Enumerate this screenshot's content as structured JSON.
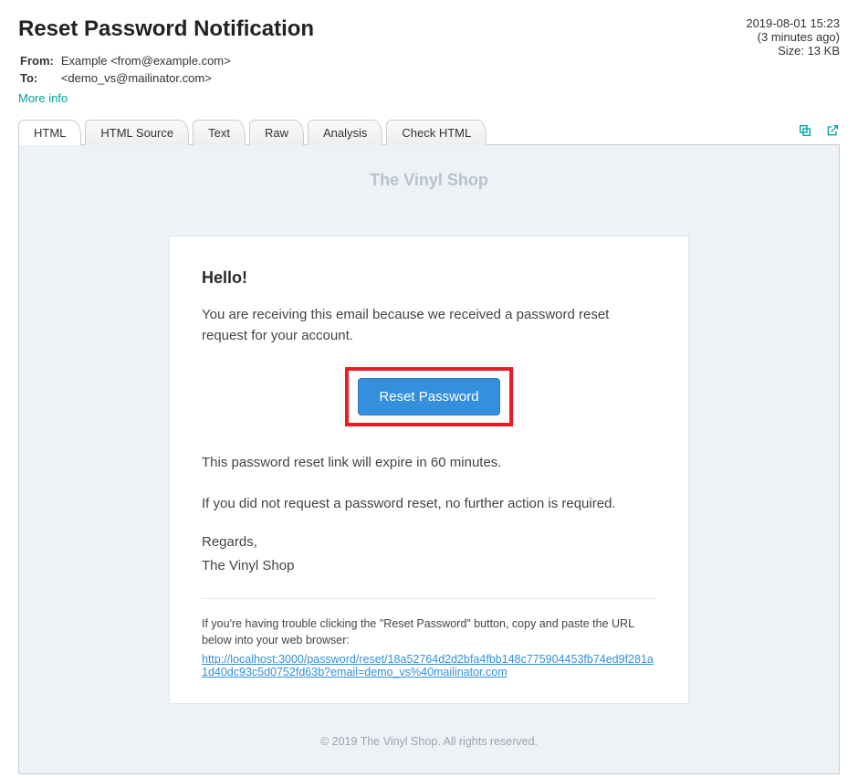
{
  "header": {
    "title": "Reset Password Notification",
    "from_label": "From:",
    "from_value": "Example <from@example.com>",
    "to_label": "To:",
    "to_value": "<demo_vs@mailinator.com>",
    "more_info": "More info",
    "timestamp": "2019-08-01 15:23",
    "relative": "(3 minutes ago)",
    "size": "Size: 13 KB"
  },
  "tabs": {
    "html": "HTML",
    "html_source": "HTML Source",
    "text": "Text",
    "raw": "Raw",
    "analysis": "Analysis",
    "check_html": "Check HTML"
  },
  "email": {
    "brand": "The Vinyl Shop",
    "greeting": "Hello!",
    "intro": "You are receiving this email because we received a password reset request for your account.",
    "button_label": "Reset Password",
    "expiry": "This password reset link will expire in 60 minutes.",
    "no_action": "If you did not request a password reset, no further action is required.",
    "regards": "Regards,",
    "team": "The Vinyl Shop",
    "fallback_instructions": "If you're having trouble clicking the \"Reset Password\" button, copy and paste the URL below into your web browser:",
    "fallback_url": "http://localhost:3000/password/reset/18a52764d2d2bfa4fbb148c775904453fb74ed9f281a1d40dc93c5d0752fd63b?email=demo_vs%40mailinator.com",
    "footer": "© 2019 The Vinyl Shop. All rights reserved."
  }
}
